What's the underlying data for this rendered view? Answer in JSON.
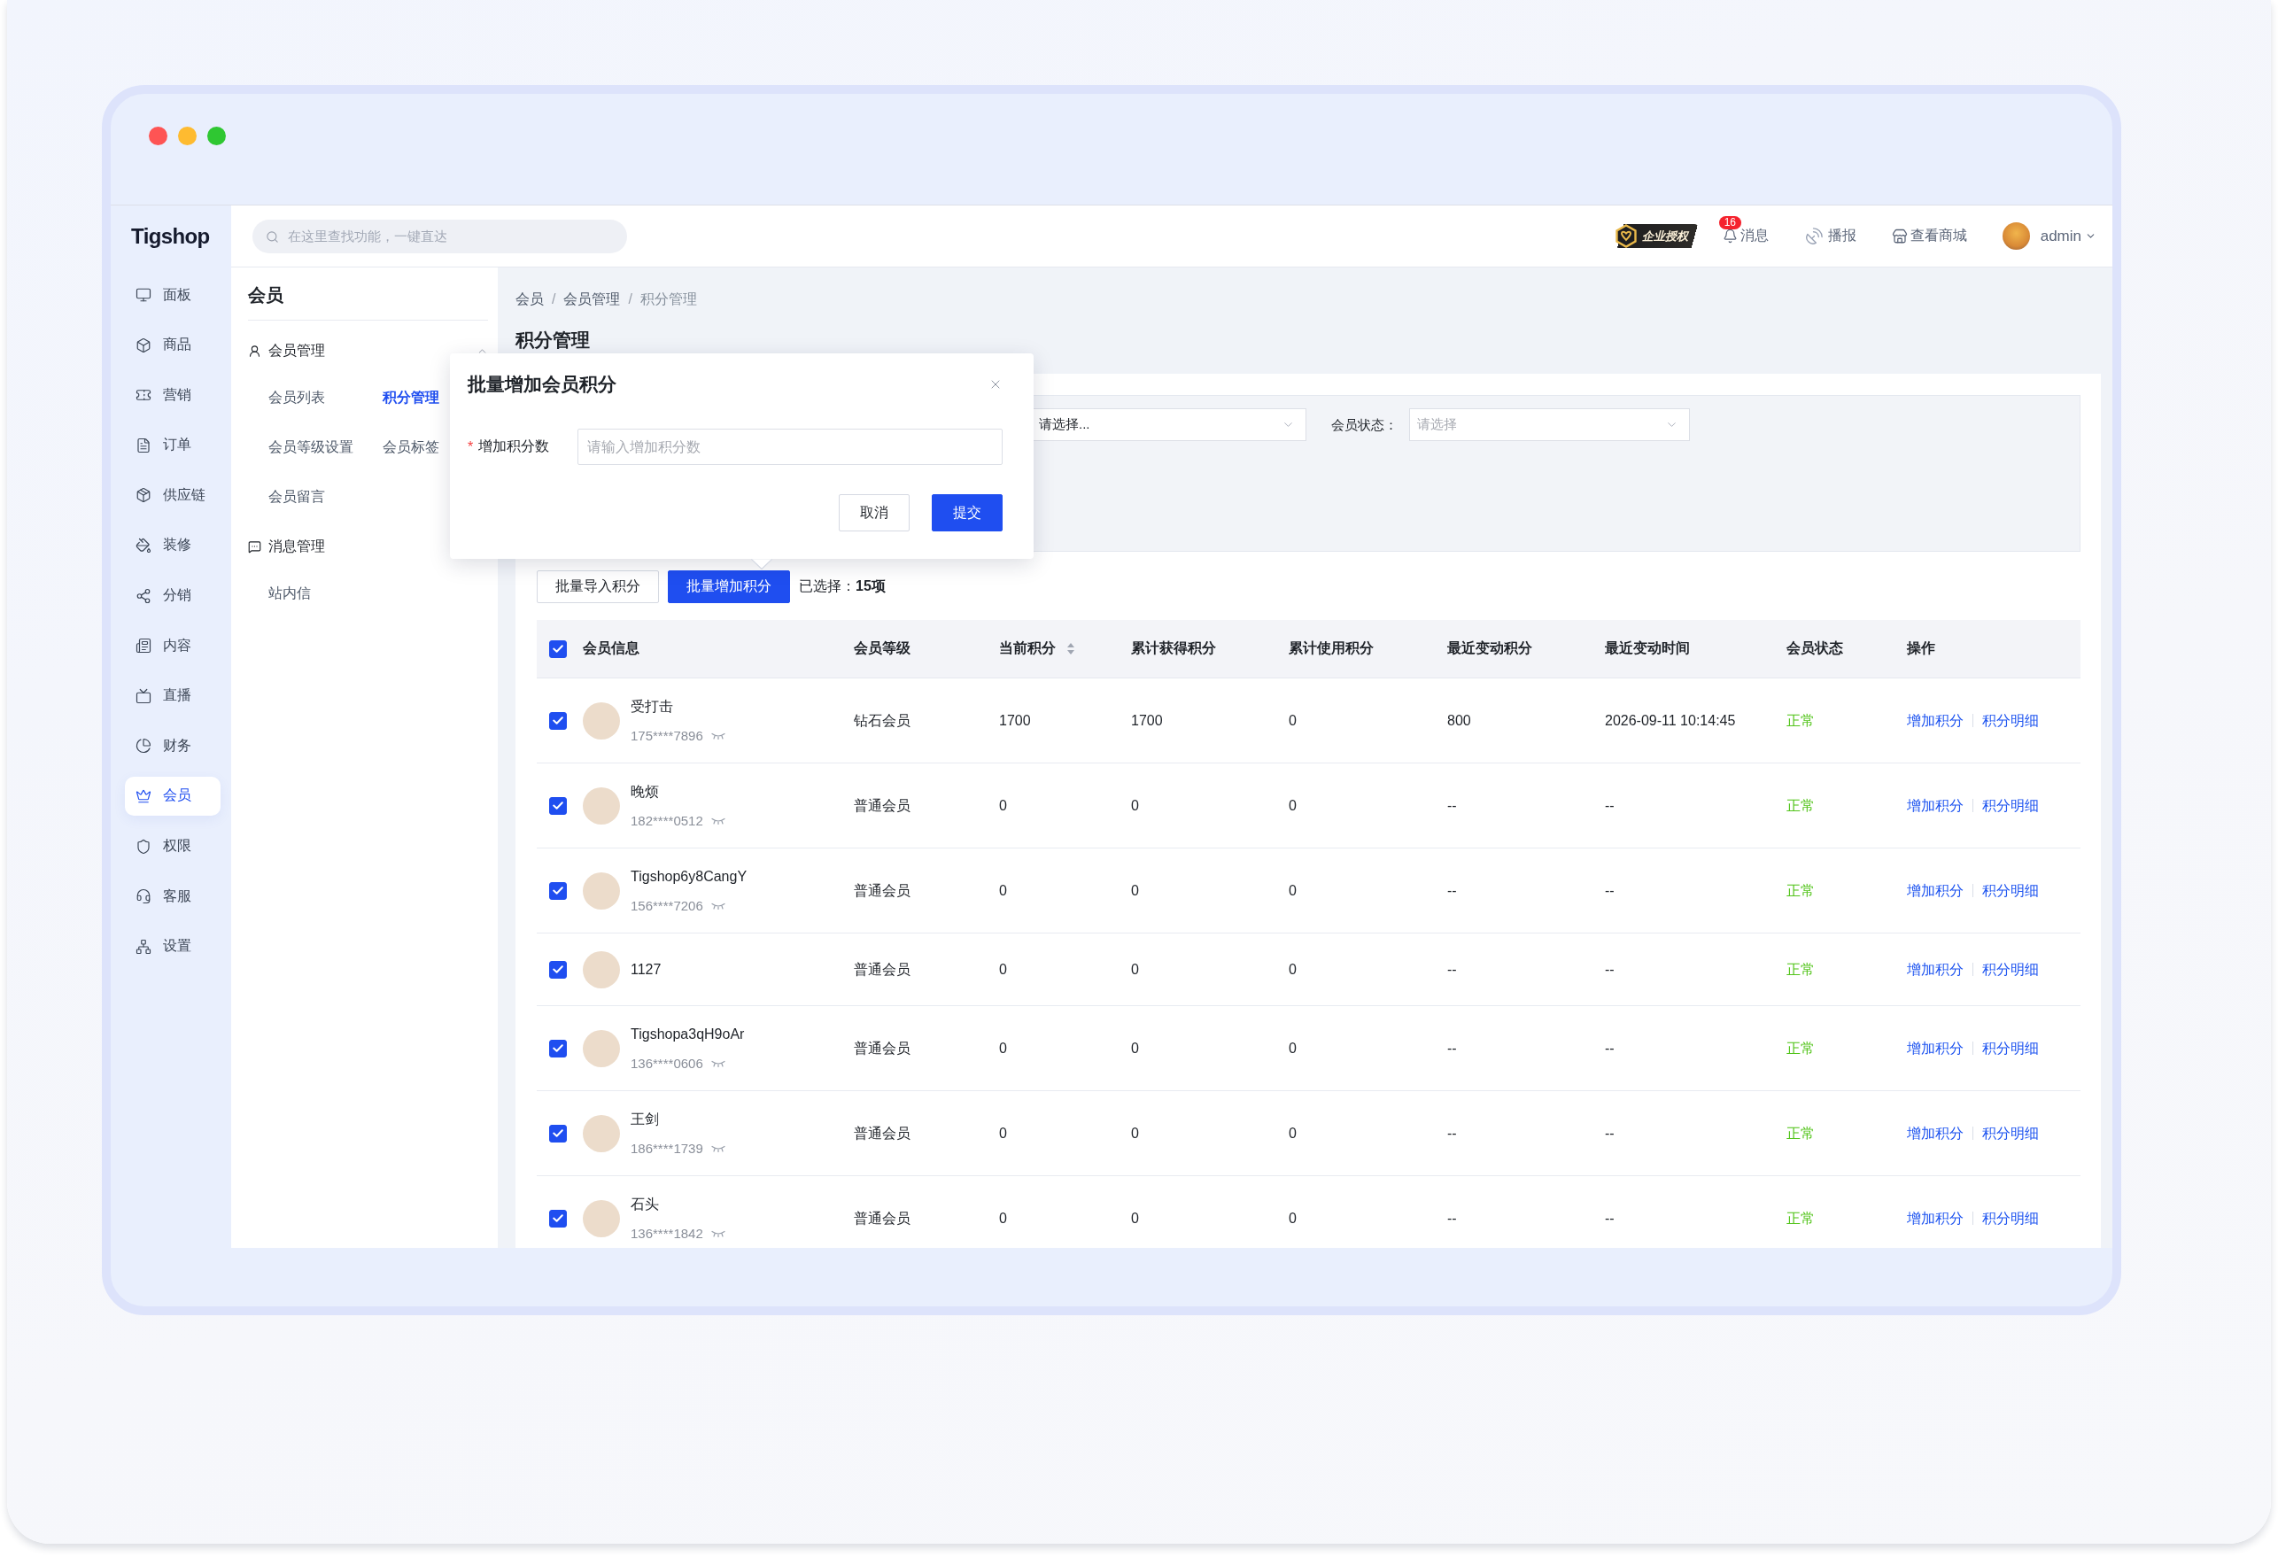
{
  "window": {
    "traffic_lights": [
      {
        "color": "#fe5454"
      },
      {
        "color": "#febb30"
      },
      {
        "color": "#2fc732"
      }
    ]
  },
  "logo": "Tigshop",
  "nav": [
    {
      "label": "面板",
      "selected": false
    },
    {
      "label": "商品",
      "selected": false
    },
    {
      "label": "营销",
      "selected": false
    },
    {
      "label": "订单",
      "selected": false
    },
    {
      "label": "供应链",
      "selected": false
    },
    {
      "label": "装修",
      "selected": false
    },
    {
      "label": "分销",
      "selected": false
    },
    {
      "label": "内容",
      "selected": false
    },
    {
      "label": "直播",
      "selected": false
    },
    {
      "label": "财务",
      "selected": false
    },
    {
      "label": "会员",
      "selected": true
    },
    {
      "label": "权限",
      "selected": false
    },
    {
      "label": "客服",
      "selected": false
    },
    {
      "label": "设置",
      "selected": false
    }
  ],
  "header": {
    "search": {
      "placeholder": "在这里查找功能，一键直达"
    },
    "license_badge": "企业授权",
    "messages": {
      "label": "消息",
      "count": "16"
    },
    "broadcast": "播报",
    "view_shop": "查看商城",
    "user": "admin"
  },
  "submenu": {
    "title": "会员",
    "groups": [
      {
        "label": "会员管理",
        "expanded": true,
        "items": [
          {
            "label": "会员列表",
            "selected": false
          },
          {
            "label": "积分管理",
            "selected": true
          },
          {
            "label": "会员等级设置",
            "selected": false
          },
          {
            "label": "会员标签",
            "selected": false
          },
          {
            "label": "会员留言",
            "selected": false
          }
        ]
      },
      {
        "label": "消息管理",
        "items": [
          {
            "label": "站内信",
            "selected": false
          }
        ]
      }
    ]
  },
  "breadcrumb": [
    {
      "label": "会员",
      "separator": "/"
    },
    {
      "label": "会员管理",
      "separator": "/"
    },
    {
      "label": "积分管理"
    }
  ],
  "page_title": "积分管理",
  "filters": [
    {
      "value": "请选择..."
    },
    {
      "label": "会员状态：",
      "placeholder": "请选择"
    }
  ],
  "toolbar": {
    "buttons": [
      {
        "label": "批量导入积分",
        "kind": "default"
      },
      {
        "label": "批量增加积分",
        "kind": "primary"
      }
    ],
    "selection": "已选择：**15项**"
  },
  "table": {
    "select_all": {
      "checked": true
    },
    "columns": [
      {
        "label": "会员信息",
        "sortable": false
      },
      {
        "label": "会员等级",
        "sortable": false
      },
      {
        "label": "当前积分",
        "sortable": true
      },
      {
        "label": "累计获得积分",
        "sortable": false
      },
      {
        "label": "累计使用积分",
        "sortable": false
      },
      {
        "label": "最近变动积分",
        "sortable": false
      },
      {
        "label": "最近变动时间",
        "sortable": false
      },
      {
        "label": "会员状态",
        "sortable": false
      },
      {
        "label": "操作",
        "sortable": false
      }
    ],
    "rows": [
      {
        "checked": true,
        "name": "受打击",
        "phone": "175****7896",
        "grade": "钻石会员",
        "current": "1700",
        "earned": "1700",
        "used": "0",
        "recent_change": "800",
        "recent_time": "2026-09-11 10:14:45",
        "status": "正常",
        "actions": [
          "增加积分",
          "积分明细"
        ]
      },
      {
        "checked": true,
        "name": "晚烦",
        "phone": "182****0512",
        "grade": "普通会员",
        "current": "0",
        "earned": "0",
        "used": "0",
        "recent_change": "--",
        "recent_time": "--",
        "status": "正常",
        "actions": [
          "增加积分",
          "积分明细"
        ]
      },
      {
        "checked": true,
        "name": "Tigshop6y8CangY",
        "phone": "156****7206",
        "grade": "普通会员",
        "current": "0",
        "earned": "0",
        "used": "0",
        "recent_change": "--",
        "recent_time": "--",
        "status": "正常",
        "actions": [
          "增加积分",
          "积分明细"
        ]
      },
      {
        "checked": true,
        "name": "1127",
        "grade": "普通会员",
        "current": "0",
        "earned": "0",
        "used": "0",
        "recent_change": "--",
        "recent_time": "--",
        "status": "正常",
        "actions": [
          "增加积分",
          "积分明细"
        ]
      },
      {
        "checked": true,
        "name": "Tigshopa3qH9oAr",
        "phone": "136****0606",
        "grade": "普通会员",
        "current": "0",
        "earned": "0",
        "used": "0",
        "recent_change": "--",
        "recent_time": "--",
        "status": "正常",
        "actions": [
          "增加积分",
          "积分明细"
        ]
      },
      {
        "checked": true,
        "name": "王剑",
        "phone": "186****1739",
        "grade": "普通会员",
        "current": "0",
        "earned": "0",
        "used": "0",
        "recent_change": "--",
        "recent_time": "--",
        "status": "正常",
        "actions": [
          "增加积分",
          "积分明细"
        ]
      },
      {
        "checked": true,
        "name": "石头",
        "phone": "136****1842",
        "grade": "普通会员",
        "current": "0",
        "earned": "0",
        "used": "0",
        "recent_change": "--",
        "recent_time": "--",
        "status": "正常",
        "actions": [
          "增加积分",
          "积分明细"
        ]
      }
    ]
  },
  "dialog": {
    "title": "批量增加会员积分",
    "field": {
      "required_mark": "*",
      "label": "增加积分数",
      "placeholder": "请输入增加积分数"
    },
    "buttons": [
      {
        "label": "取消",
        "kind": "default"
      },
      {
        "label": "提交",
        "kind": "primary"
      }
    ]
  }
}
